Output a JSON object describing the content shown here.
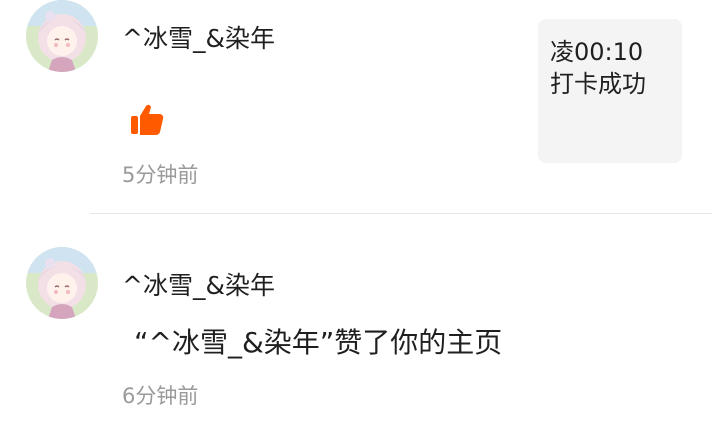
{
  "notifications": [
    {
      "username": "^冰雪_&染年",
      "content_icon": "thumbs-up-icon",
      "time": "5分钟前",
      "preview": {
        "line1": "凌00:10",
        "line2": "打卡成功"
      }
    },
    {
      "username": "^冰雪_&染年",
      "message": "“^冰雪_&染年”赞了你的主页",
      "time": "6分钟前"
    }
  ],
  "colors": {
    "like_icon": "#ff5a00",
    "time_text": "#9a9a9a",
    "preview_bg": "#f4f4f4",
    "divider": "#e6e6e6"
  }
}
